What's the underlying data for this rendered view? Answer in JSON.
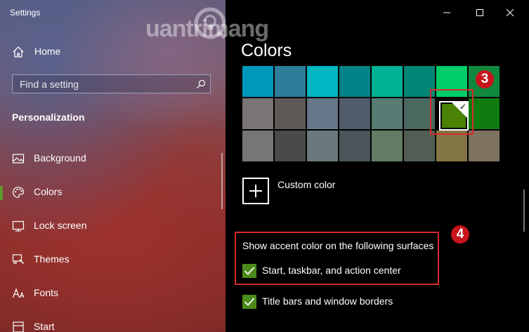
{
  "window": {
    "title": "Settings"
  },
  "watermark": {
    "text": "uantrimang"
  },
  "sidebar": {
    "home_label": "Home",
    "search_placeholder": "Find a setting",
    "section_title": "Personalization",
    "items": [
      {
        "label": "Background",
        "icon": "picture-icon"
      },
      {
        "label": "Colors",
        "icon": "palette-icon",
        "selected": true
      },
      {
        "label": "Lock screen",
        "icon": "lock-screen-icon"
      },
      {
        "label": "Themes",
        "icon": "brush-icon"
      },
      {
        "label": "Fonts",
        "icon": "font-icon"
      },
      {
        "label": "Start",
        "icon": "start-icon"
      }
    ]
  },
  "main": {
    "page_title": "Colors",
    "color_grid": [
      [
        "#0099bc",
        "#2d7d9a",
        "#00b7c3",
        "#038387",
        "#00b294",
        "#018574",
        "#00cc6a",
        "#10893e"
      ],
      [
        "#7a7574",
        "#5d5a58",
        "#68768a",
        "#515c6b",
        "#567c73",
        "#486860",
        "#498205",
        "#107c10"
      ],
      [
        "#767676",
        "#4c4a48",
        "#69797e",
        "#4a5459",
        "#647c64",
        "#525e54",
        "#847545",
        "#7e735f"
      ]
    ],
    "selected_color": "#498205",
    "annotation_3": "3",
    "custom_color_label": "Custom color",
    "surfaces_title": "Show accent color on the following surfaces",
    "annotation_4": "4",
    "checkbox_start": {
      "label": "Start, taskbar, and action center",
      "checked": true
    },
    "checkbox_titlebars": {
      "label": "Title bars and window borders",
      "checked": true
    }
  }
}
